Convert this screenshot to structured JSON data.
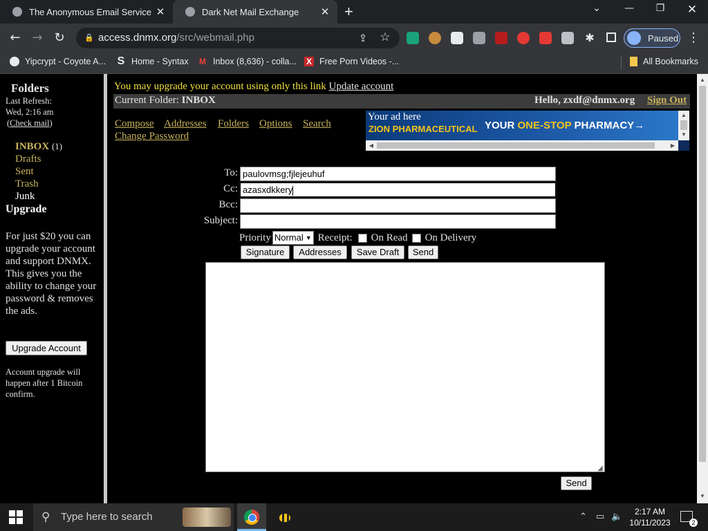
{
  "browser": {
    "tabs": [
      {
        "title": "The Anonymous Email Service Fo"
      },
      {
        "title": "Dark Net Mail Exchange"
      }
    ],
    "url_domain": "access.dnmx.org",
    "url_path": "/src/webmail.php",
    "profile_label": "Paused",
    "bookmarks": [
      {
        "label": "Yipcrypt - Coyote A...",
        "icon": "github-icon"
      },
      {
        "label": "Home - Syntax",
        "icon": "S"
      },
      {
        "label": "Inbox (8,636) - colla...",
        "icon": "gmail-icon"
      },
      {
        "label": "Free Porn Videos -...",
        "icon": "X"
      }
    ],
    "all_bookmarks": "All Bookmarks"
  },
  "sidebar": {
    "title": "Folders",
    "last_refresh_label": "Last Refresh:",
    "last_refresh_time": "Wed, 2:16 am",
    "check_mail": "Check mail",
    "folders": [
      {
        "name": "INBOX",
        "count": "(1)"
      },
      {
        "name": "Drafts"
      },
      {
        "name": "Sent"
      },
      {
        "name": "Trash"
      },
      {
        "name": "Junk"
      }
    ],
    "upgrade_heading": "Upgrade",
    "promo": "For just $20 you can upgrade your account and support DNMX. This gives you the ability to change your password & removes the ads.",
    "upgrade_button": "Upgrade Account",
    "upgrade_note": "Account upgrade will happen after 1 Bitcoin confirm."
  },
  "header": {
    "notice": "You may upgrade your account using only this link",
    "notice_link": "Update account",
    "current_folder_label": "Current Folder:",
    "current_folder": "INBOX",
    "hello": "Hello, zxdf@dnmx.org",
    "sign_out": "Sign Out"
  },
  "menu": {
    "items": [
      "Compose",
      "Addresses",
      "Folders",
      "Options",
      "Search"
    ],
    "change_password": "Change Password"
  },
  "ad": {
    "label": "Your ad here",
    "brand": "ZION PHARMACEUTICAL",
    "tagline_1": "YOUR",
    "tagline_2": "ONE-STOP",
    "tagline_3": "PHARMACY",
    "tagline_arrow": "→"
  },
  "compose": {
    "to_label": "To:",
    "to_value": "paulovmsg;fjlejeuhuf",
    "cc_label": "Cc:",
    "cc_value": "azasxdkkery",
    "bcc_label": "Bcc:",
    "bcc_value": "",
    "subject_label": "Subject:",
    "subject_value": "",
    "priority_label": "Priority",
    "priority_value": "Normal",
    "receipt_label": "Receipt:",
    "on_read": "On Read",
    "on_delivery": "On Delivery",
    "buttons": {
      "signature": "Signature",
      "addresses": "Addresses",
      "save_draft": "Save Draft",
      "send": "Send"
    },
    "body": "",
    "send_bottom": "Send"
  },
  "taskbar": {
    "search_placeholder": "Type here to search",
    "time": "2:17 AM",
    "date": "10/11/2023",
    "notification_count": "2"
  }
}
